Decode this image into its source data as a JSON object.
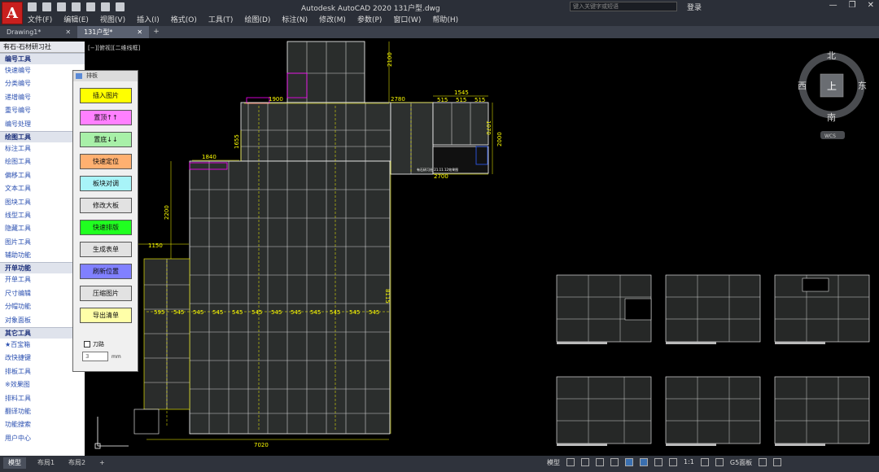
{
  "app": {
    "logo_letter": "A",
    "title": "Autodesk AutoCAD 2020    131户型.dwg"
  },
  "search": {
    "placeholder": "键入关键字或短语"
  },
  "account": {
    "login": "登录"
  },
  "window_controls": [
    "—",
    "❐",
    "✕"
  ],
  "menu": [
    "文件(F)",
    "编辑(E)",
    "视图(V)",
    "插入(I)",
    "格式(O)",
    "工具(T)",
    "绘图(D)",
    "标注(N)",
    "修改(M)",
    "参数(P)",
    "窗口(W)",
    "帮助(H)"
  ],
  "tabs": [
    {
      "label": "Drawing1*",
      "close": "✕"
    },
    {
      "label": "131户型*",
      "close": "✕"
    }
  ],
  "tab_add": "+",
  "viewport_label": "[−][俯视][二维线框]",
  "sidebar": {
    "title": "有石-石材研习社",
    "groups": [
      {
        "heading": "编号工具",
        "items": [
          "快速编号",
          "分类编号",
          "递增编号",
          "重号编号",
          "编号处理"
        ]
      },
      {
        "heading": "绘图工具",
        "items": [
          "标注工具",
          "绘图工具",
          "偏移工具",
          "文本工具",
          "图块工具",
          "线型工具",
          "隐藏工具",
          "图片工具",
          "辅助功能"
        ]
      },
      {
        "heading": "开单功能",
        "items": [
          "开单工具",
          "尺寸编辑",
          "分帽功能",
          "对象面板"
        ]
      },
      {
        "heading": "其它工具",
        "items": [
          "★百宝箱",
          "改快捷键",
          "排板工具",
          "※效果图",
          "排料工具",
          "翻译功能",
          "功能搜索",
          "用户中心"
        ]
      }
    ]
  },
  "palette": {
    "title": "排板",
    "buttons": [
      {
        "label": "插入图片",
        "color": "#ffff00"
      },
      {
        "label": "置顶↑↑",
        "color": "#ff80ff"
      },
      {
        "label": "置底↓↓",
        "color": "#a8f0a8"
      },
      {
        "label": "快速定位",
        "color": "#ffb070"
      },
      {
        "label": "板块对调",
        "color": "#a8f4f8"
      },
      {
        "label": "修改大板",
        "color": "#e2e2e2"
      },
      {
        "label": "快速排版",
        "color": "#20ff20"
      },
      {
        "label": "生成表单",
        "color": "#e2e2e2"
      },
      {
        "label": "刷新位置",
        "color": "#8080ff"
      },
      {
        "label": "压缩图片",
        "color": "#e2e2e2"
      },
      {
        "label": "导出清单",
        "color": "#ffffa8"
      }
    ],
    "checkbox_label": "刀路",
    "input_value": "3",
    "unit": "mm"
  },
  "compass": {
    "north": "北",
    "south": "南",
    "east": "东",
    "west": "西",
    "top": "上",
    "wcs": "WCS"
  },
  "dimensions": {
    "top_vertical": "2100",
    "d1900": "1900",
    "d2780": "2780",
    "d1545": "1545",
    "d515a": "515",
    "d515b": "515",
    "d515c": "515",
    "d1070": "1070",
    "d2000": "2000",
    "d1655": "1655",
    "d1840": "1840",
    "d2700": "2700",
    "d2200": "2200",
    "d1150": "1150",
    "d8115": "8115",
    "d7020": "7020",
    "row_545": [
      "595",
      "545",
      "545",
      "545",
      "545",
      "545",
      "545",
      "545",
      "545",
      "545",
      "545",
      "545",
      "545"
    ]
  },
  "annotation_text": "有石研习社 21.11.12效果图",
  "status": {
    "tabs": [
      "模型",
      "布局1",
      "布局2"
    ],
    "add": "+",
    "model_button": "模型",
    "scale": "1:1",
    "panel": "G5面板"
  },
  "colors": {
    "accent": "#3a6fb0",
    "tile_label": "#00ff00",
    "dim": "#ffff00",
    "outline": "#ffffff",
    "brand": "#c8201e"
  }
}
